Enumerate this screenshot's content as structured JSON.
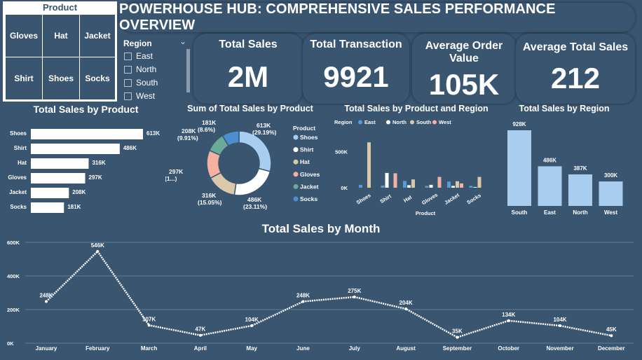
{
  "product_slicer": {
    "title": "Product",
    "items": [
      "Gloves",
      "Hat",
      "Jacket",
      "Shirt",
      "Shoes",
      "Socks"
    ]
  },
  "region_slicer": {
    "title": "Region",
    "items": [
      "East",
      "North",
      "South",
      "West"
    ]
  },
  "banner": {
    "title": "POWERHOUSE HUB: COMPREHENSIVE SALES PERFORMANCE OVERVIEW"
  },
  "kpis": [
    {
      "label": "Total Sales",
      "value": "2M"
    },
    {
      "label": "Total Transaction",
      "value": "9921"
    },
    {
      "label": "Average Order Value",
      "value": "105K"
    },
    {
      "label": "Average Total Sales",
      "value": "212"
    }
  ],
  "colors": {
    "background": "#3a5570",
    "bar_light": "#a9cdef",
    "east": "#5b9bd5",
    "north": "#ffffff",
    "south": "#d9c9a8",
    "gloves": "#f4b0a0",
    "jacket": "#6aaa96",
    "socks": "#4c8ed0"
  },
  "chart_data": [
    {
      "type": "bar",
      "orientation": "horizontal",
      "title": "Total Sales by Product",
      "categories": [
        "Shoes",
        "Shirt",
        "Hat",
        "Gloves",
        "Jacket",
        "Socks"
      ],
      "values": [
        613000,
        486000,
        316000,
        297000,
        208000,
        181000
      ],
      "labels": [
        "613K",
        "486K",
        "316K",
        "297K",
        "208K",
        "181K"
      ]
    },
    {
      "type": "pie",
      "title": "Sum of Total Sales by Product",
      "legend_title": "Product",
      "categories": [
        "Shoes",
        "Shirt",
        "Hat",
        "Gloves",
        "Jacket",
        "Socks"
      ],
      "values": [
        613000,
        486000,
        316000,
        297000,
        208000,
        181000
      ],
      "value_labels": [
        "613K",
        "486K",
        "316K",
        "297K",
        "208K",
        "181K"
      ],
      "pct_labels": [
        "(29.19%)",
        "(23.11%)",
        "(15.05%)",
        "(1...)",
        "(9.91%)",
        "(8.6%)"
      ],
      "legend_position": "right"
    },
    {
      "type": "bar",
      "title": "Total Sales by Product and Region",
      "legend_title": "Region",
      "xlabel": "Product",
      "categories": [
        "Shoes",
        "Shirt",
        "Hat",
        "Gloves",
        "Jacket",
        "Socks"
      ],
      "series": [
        {
          "name": "East",
          "values": [
            40000,
            30000,
            95000,
            25000,
            85000,
            25000
          ]
        },
        {
          "name": "North",
          "values": [
            0,
            205000,
            35000,
            40000,
            25000,
            10000
          ]
        },
        {
          "name": "South",
          "values": [
            630000,
            0,
            115000,
            0,
            90000,
            150000
          ]
        },
        {
          "name": "West",
          "values": [
            0,
            200000,
            0,
            150000,
            60000,
            0
          ]
        }
      ],
      "yticks": [
        "0K",
        "500K"
      ],
      "ylim": [
        0,
        700000
      ]
    },
    {
      "type": "bar",
      "title": "Total Sales by Region",
      "categories": [
        "South",
        "East",
        "North",
        "West"
      ],
      "values": [
        928000,
        486000,
        387000,
        300000
      ],
      "labels": [
        "928K",
        "486K",
        "387K",
        "300K"
      ]
    },
    {
      "type": "line",
      "title": "Total Sales by Month",
      "categories": [
        "January",
        "February",
        "March",
        "April",
        "May",
        "June",
        "July",
        "August",
        "September",
        "October",
        "November",
        "December"
      ],
      "values": [
        248000,
        546000,
        107000,
        47000,
        104000,
        248000,
        275000,
        204000,
        35000,
        134000,
        104000,
        45000
      ],
      "labels": [
        "248K",
        "546K",
        "107K",
        "47K",
        "104K",
        "248K",
        "275K",
        "204K",
        "35K",
        "134K",
        "104K",
        "45K"
      ],
      "yticks": [
        "0K",
        "200K",
        "400K",
        "600K"
      ],
      "ylim": [
        0,
        600000
      ],
      "grid": true
    }
  ]
}
